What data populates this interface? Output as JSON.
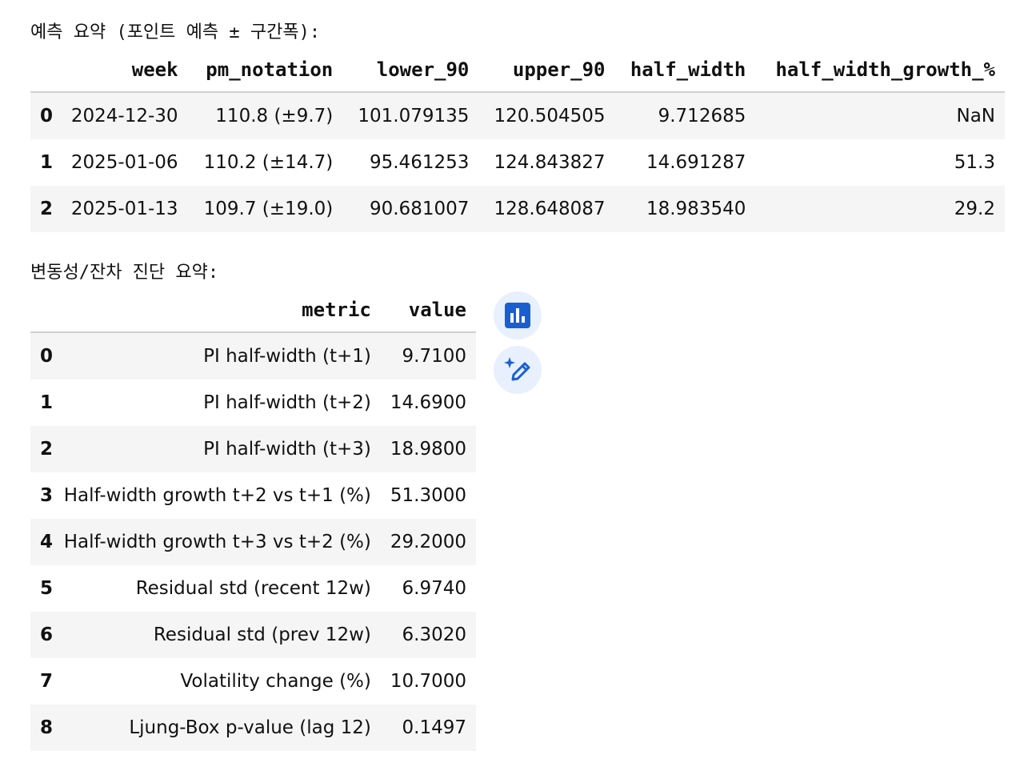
{
  "captions": {
    "forecast": "예측 요약 (포인트 예측 ± 구간폭):",
    "diagnostics": "변동성/잔차 진단 요약:"
  },
  "forecast_table": {
    "columns": [
      "",
      "week",
      "pm_notation",
      "lower_90",
      "upper_90",
      "half_width",
      "half_width_growth_%"
    ],
    "rows": [
      [
        "0",
        "2024-12-30",
        "110.8 (±9.7)",
        "101.079135",
        "120.504505",
        "9.712685",
        "NaN"
      ],
      [
        "1",
        "2025-01-06",
        "110.2 (±14.7)",
        "95.461253",
        "124.843827",
        "14.691287",
        "51.3"
      ],
      [
        "2",
        "2025-01-13",
        "109.7 (±19.0)",
        "90.681007",
        "128.648087",
        "18.983540",
        "29.2"
      ]
    ]
  },
  "diagnostics_table": {
    "columns": [
      "",
      "metric",
      "value"
    ],
    "rows": [
      [
        "0",
        "PI half-width (t+1)",
        "9.7100"
      ],
      [
        "1",
        "PI half-width (t+2)",
        "14.6900"
      ],
      [
        "2",
        "PI half-width (t+3)",
        "18.9800"
      ],
      [
        "3",
        "Half-width growth t+2 vs t+1 (%)",
        "51.3000"
      ],
      [
        "4",
        "Half-width growth t+3 vs t+2 (%)",
        "29.2000"
      ],
      [
        "5",
        "Residual std (recent 12w)",
        "6.9740"
      ],
      [
        "6",
        "Residual std (prev 12w)",
        "6.3020"
      ],
      [
        "7",
        "Volatility change (%)",
        "10.7000"
      ],
      [
        "8",
        "Ljung-Box p-value (lag 12)",
        "0.1497"
      ]
    ]
  },
  "actions": {
    "chart_icon": "bar-chart-icon",
    "magic_icon": "magic-pen-icon",
    "accent": "#1a5fd0",
    "fab_bg": "#e8f0fe"
  }
}
